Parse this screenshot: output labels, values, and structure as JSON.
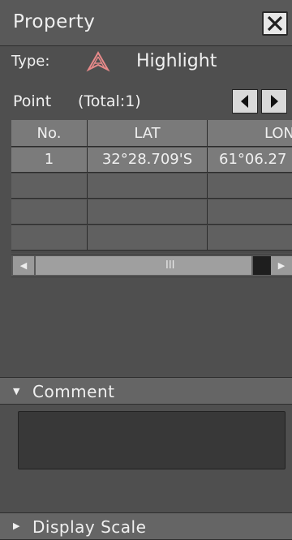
{
  "window": {
    "title": "Property"
  },
  "type": {
    "label": "Type:",
    "value": "Highlight",
    "icon": "highlight-triangle-icon",
    "icon_color": "#e88a8a"
  },
  "points": {
    "label": "Point",
    "total": "(Total:1)",
    "columns": [
      "No.",
      "LAT",
      "LON"
    ],
    "rows": [
      [
        "1",
        "32°28.709'S",
        "61°06.27"
      ],
      [
        "",
        "",
        ""
      ],
      [
        "",
        "",
        ""
      ],
      [
        "",
        "",
        ""
      ]
    ]
  },
  "scrollbar": {
    "grip": "III"
  },
  "sections": {
    "comment": "Comment",
    "display_scale": "Display Scale"
  },
  "comment": {
    "value": ""
  }
}
